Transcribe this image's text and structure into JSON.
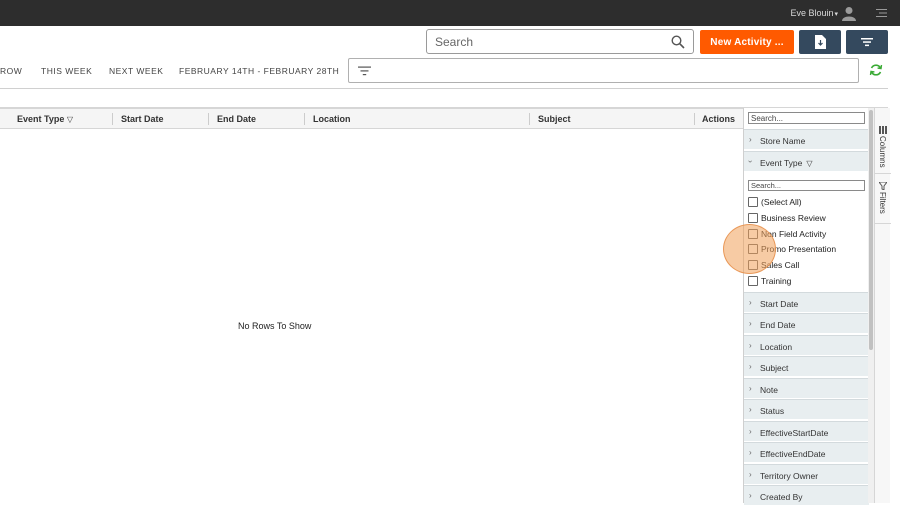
{
  "topbar": {
    "user_name": "Eve Blouin",
    "user_caret": "▾"
  },
  "toolbar": {
    "search_placeholder": "Search",
    "new_activity_label": "New Activity ..."
  },
  "date_tabs": [
    "ROW",
    "THIS WEEK",
    "NEXT WEEK",
    "FEBRUARY 14TH - FEBRUARY 28TH"
  ],
  "grid": {
    "columns": [
      "Event Type",
      "Start Date",
      "End Date",
      "Location",
      "Subject",
      "Actions"
    ],
    "event_type_filter_icon": "▽",
    "empty_message": "No Rows To Show"
  },
  "tool_panel": {
    "search_placeholder": "Search...",
    "fields": [
      {
        "label": "Store Name",
        "chevron": "›"
      },
      {
        "label": "Event Type",
        "chevron": "›",
        "expanded": true,
        "funnel": "▽"
      },
      {
        "label": "Start Date",
        "chevron": "›"
      },
      {
        "label": "End Date",
        "chevron": "›"
      },
      {
        "label": "Location",
        "chevron": "›"
      },
      {
        "label": "Subject",
        "chevron": "›"
      },
      {
        "label": "Note",
        "chevron": "›"
      },
      {
        "label": "Status",
        "chevron": "›"
      },
      {
        "label": "EffectiveStartDate",
        "chevron": "›"
      },
      {
        "label": "EffectiveEndDate",
        "chevron": "›"
      },
      {
        "label": "Territory Owner",
        "chevron": "›"
      },
      {
        "label": "Created By",
        "chevron": "›"
      }
    ],
    "event_type_filter": {
      "search_placeholder": "Search...",
      "options": [
        "(Select All)",
        "Business Review",
        "Non Field Activity",
        "Promo Presentation",
        "Sales Call",
        "Training"
      ]
    }
  },
  "side_tabs": {
    "columns_label": "Columns",
    "filters_label": "Filters"
  },
  "colors": {
    "topbar": "#2d2d2d",
    "accent_orange": "#ff5a00",
    "button_navy": "#34495e",
    "refresh_green": "#3aaa35"
  }
}
